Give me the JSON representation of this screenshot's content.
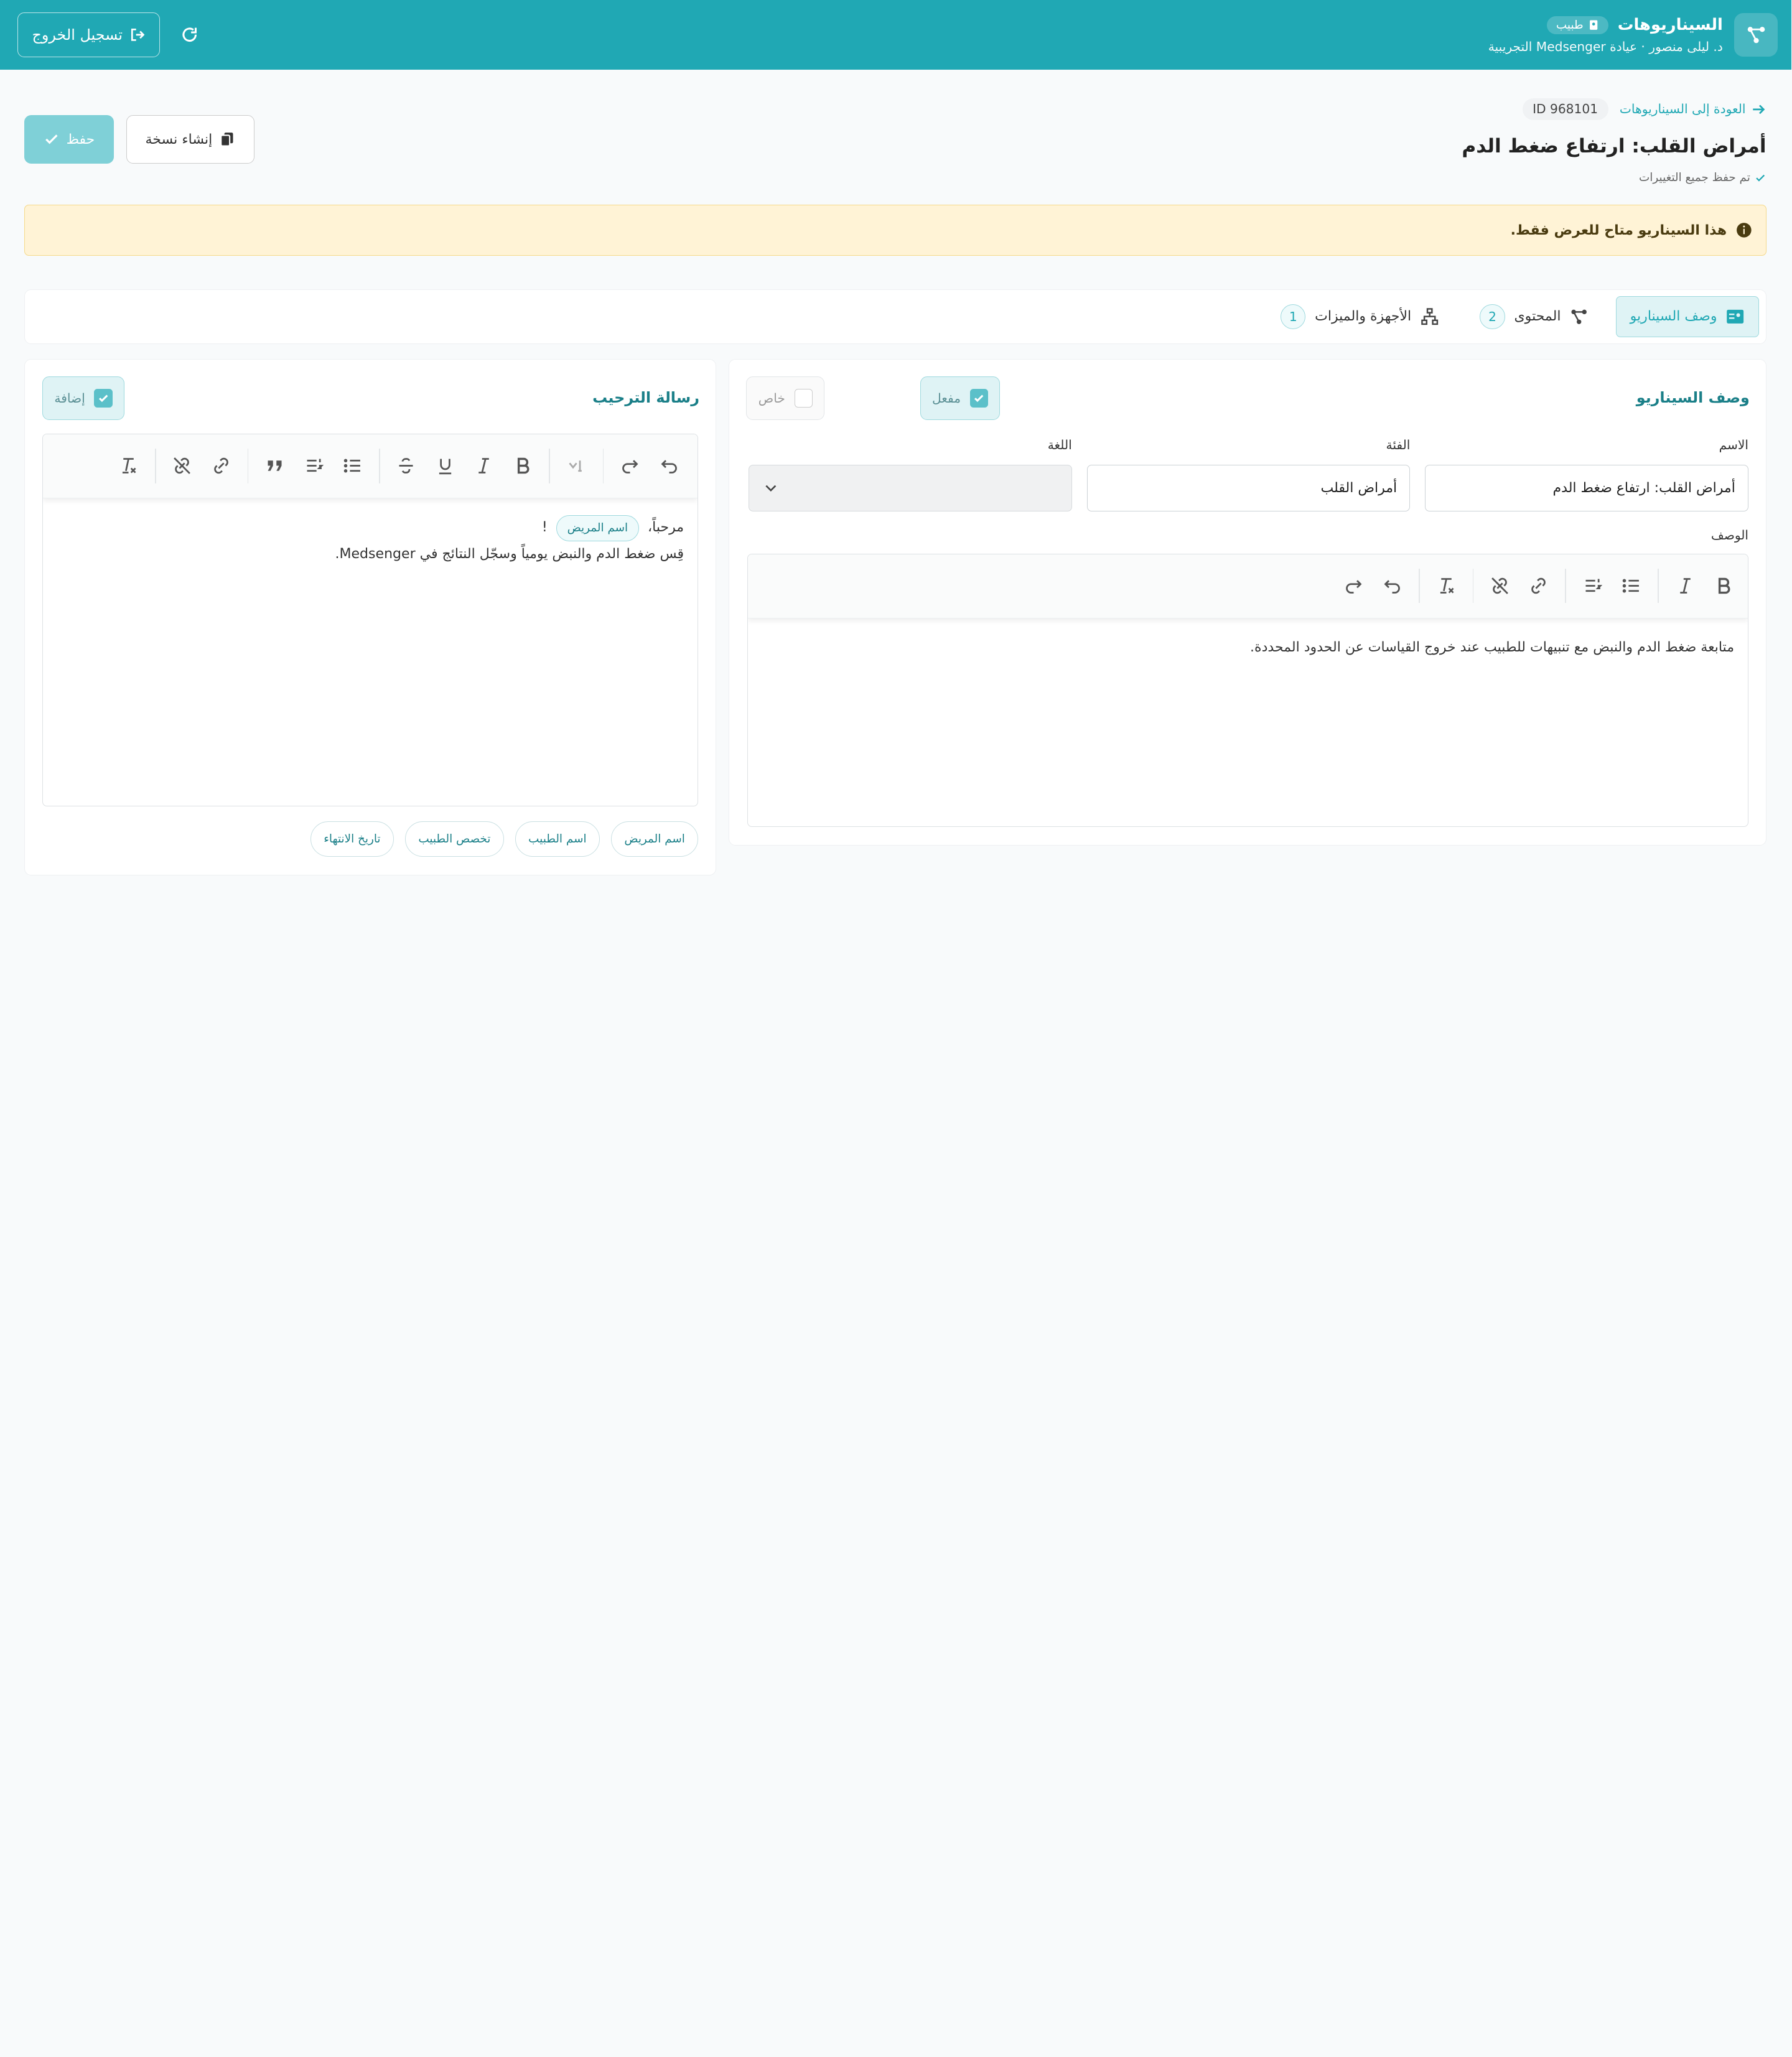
{
  "header": {
    "title": "السيناريوهات",
    "role": "طبيب",
    "subtitle": "د. ليلى منصور · عيادة Medsenger التجريبية",
    "logout_label": "تسجيل الخروج"
  },
  "scenario": {
    "back_label": "العودة إلى السيناريوهات",
    "id_label": "ID 968101",
    "title": "أمراض القلب: ارتفاع ضغط الدم",
    "saved_note": "تم حفظ جميع التغييرات",
    "save_label": "حفظ",
    "copy_label": "إنشاء نسخة"
  },
  "alert": {
    "text": "هذا السيناريو متاح للعرض فقط."
  },
  "tabs": [
    {
      "label": "وصف السيناريو",
      "active": true
    },
    {
      "label": "المحتوى",
      "count": "2"
    },
    {
      "label": "الأجهزة والميزات",
      "count": "1"
    }
  ],
  "description_panel": {
    "title": "وصف السيناريو",
    "enabled_label": "مفعل",
    "private_label": "خاص",
    "name_label": "الاسم",
    "name_value": "أمراض القلب: ارتفاع ضغط الدم",
    "category_label": "الفئة",
    "category_value": "أمراض القلب",
    "language_label": "اللغة",
    "language_value": "",
    "description_label": "الوصف",
    "description_text": "متابعة ضغط الدم والنبض مع تنبيهات للطبيب عند خروج القياسات عن الحدود المحددة."
  },
  "welcome_panel": {
    "title": "رسالة الترحيب",
    "add_label": "إضافة",
    "line1_prefix": "مرحباً،",
    "line1_chip": "اسم المريض",
    "line1_suffix": "!",
    "line2": "قِس ضغط الدم والنبض يومياً وسجّل النتائج في Medsenger.",
    "variables": [
      "اسم المريض",
      "اسم الطبيب",
      "تخصص الطبيب",
      "تاريخ الانتهاء"
    ]
  },
  "colors": {
    "primary": "#20a8b4",
    "save_button": "#7fd0d7",
    "alert_bg": "#fff3d6"
  }
}
